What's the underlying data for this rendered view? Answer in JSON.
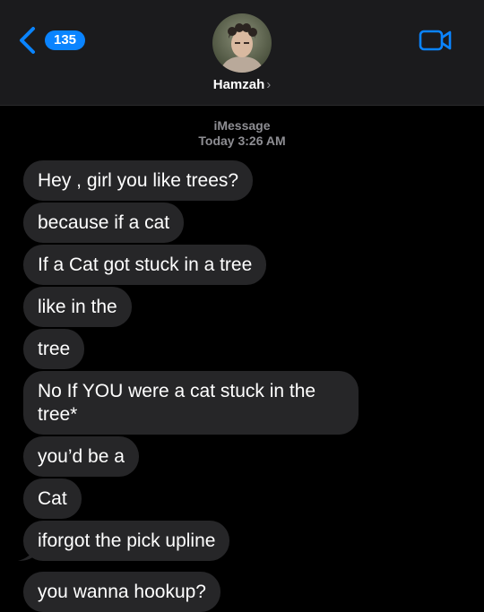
{
  "header": {
    "back_count": "135",
    "contact_name": "Hamzah",
    "contact_chevron": "›",
    "icons": {
      "back": "chevron-left-icon",
      "video": "video-camera-icon"
    },
    "accent_color": "#0a84ff"
  },
  "conversation": {
    "service": "iMessage",
    "timestamp": "Today 3:26 AM",
    "messages": [
      {
        "text": "Hey , girl you like trees?"
      },
      {
        "text": "because if a cat"
      },
      {
        "text": "If a Cat got stuck in a tree"
      },
      {
        "text": "like in the"
      },
      {
        "text": "tree"
      },
      {
        "text": "No If YOU were a cat stuck in the tree*"
      },
      {
        "text": "you’d be a"
      },
      {
        "text": "Cat"
      },
      {
        "text": "iforgot the pick upline"
      },
      {
        "text": "you wanna hookup?"
      }
    ]
  },
  "colors": {
    "incoming_bubble": "#262628",
    "background": "#000000",
    "header_background": "#1b1b1d"
  }
}
